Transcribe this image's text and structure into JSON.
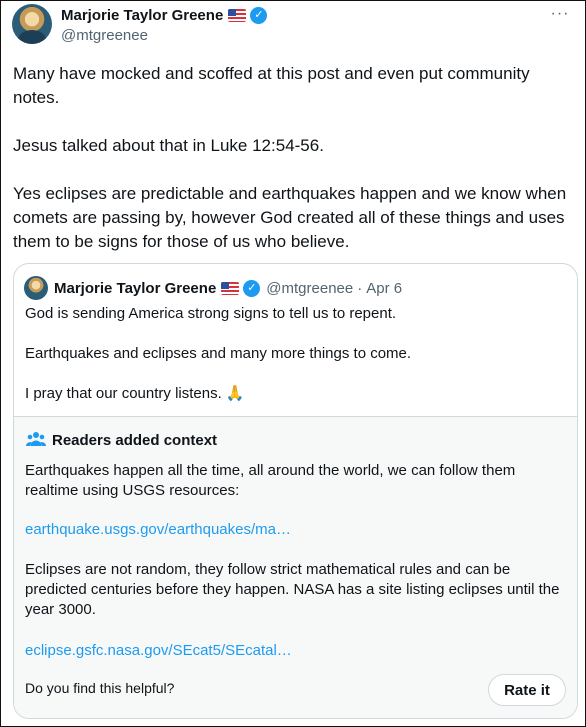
{
  "author": {
    "name": "Marjorie Taylor Greene",
    "handle": "@mtgreenee",
    "flag_icon": "us-flag-icon",
    "verified_icon": "verified-badge-icon"
  },
  "post": {
    "text": "Many have mocked and scoffed at this post and even put community notes.\n\nJesus talked about that in Luke 12:54-56.\n\nYes eclipses are predictable and earthquakes happen and we know when comets are passing by, however God created all of these things and uses them to be signs for those of us who believe."
  },
  "quoted_post": {
    "name": "Marjorie Taylor Greene",
    "handle": "@mtgreenee",
    "separator": "·",
    "date": "Apr 6",
    "text": "God is sending America strong signs to tell us to repent.\n\nEarthquakes and eclipses and many more things to come.\n\nI pray that our country listens. 🙏"
  },
  "community_note": {
    "title": "Readers added context",
    "paragraph_1": "Earthquakes happen all the time, all around the world, we can follow them realtime using USGS resources:",
    "link_1": "earthquake.usgs.gov/earthquakes/ma…",
    "paragraph_2": "Eclipses are not random, they follow strict mathematical rules and can be predicted centuries before they happen. NASA has a site listing eclipses until the year 3000.",
    "link_2": "eclipse.gsfc.nasa.gov/SEcat5/SEcatal…",
    "helpful_prompt": "Do you find this helpful?",
    "rate_button": "Rate it"
  },
  "colors": {
    "accent": "#1d9bf0",
    "text": "#0f1419",
    "secondary": "#536471",
    "note_bg": "#f7f9f9",
    "border": "#cfd9de"
  }
}
